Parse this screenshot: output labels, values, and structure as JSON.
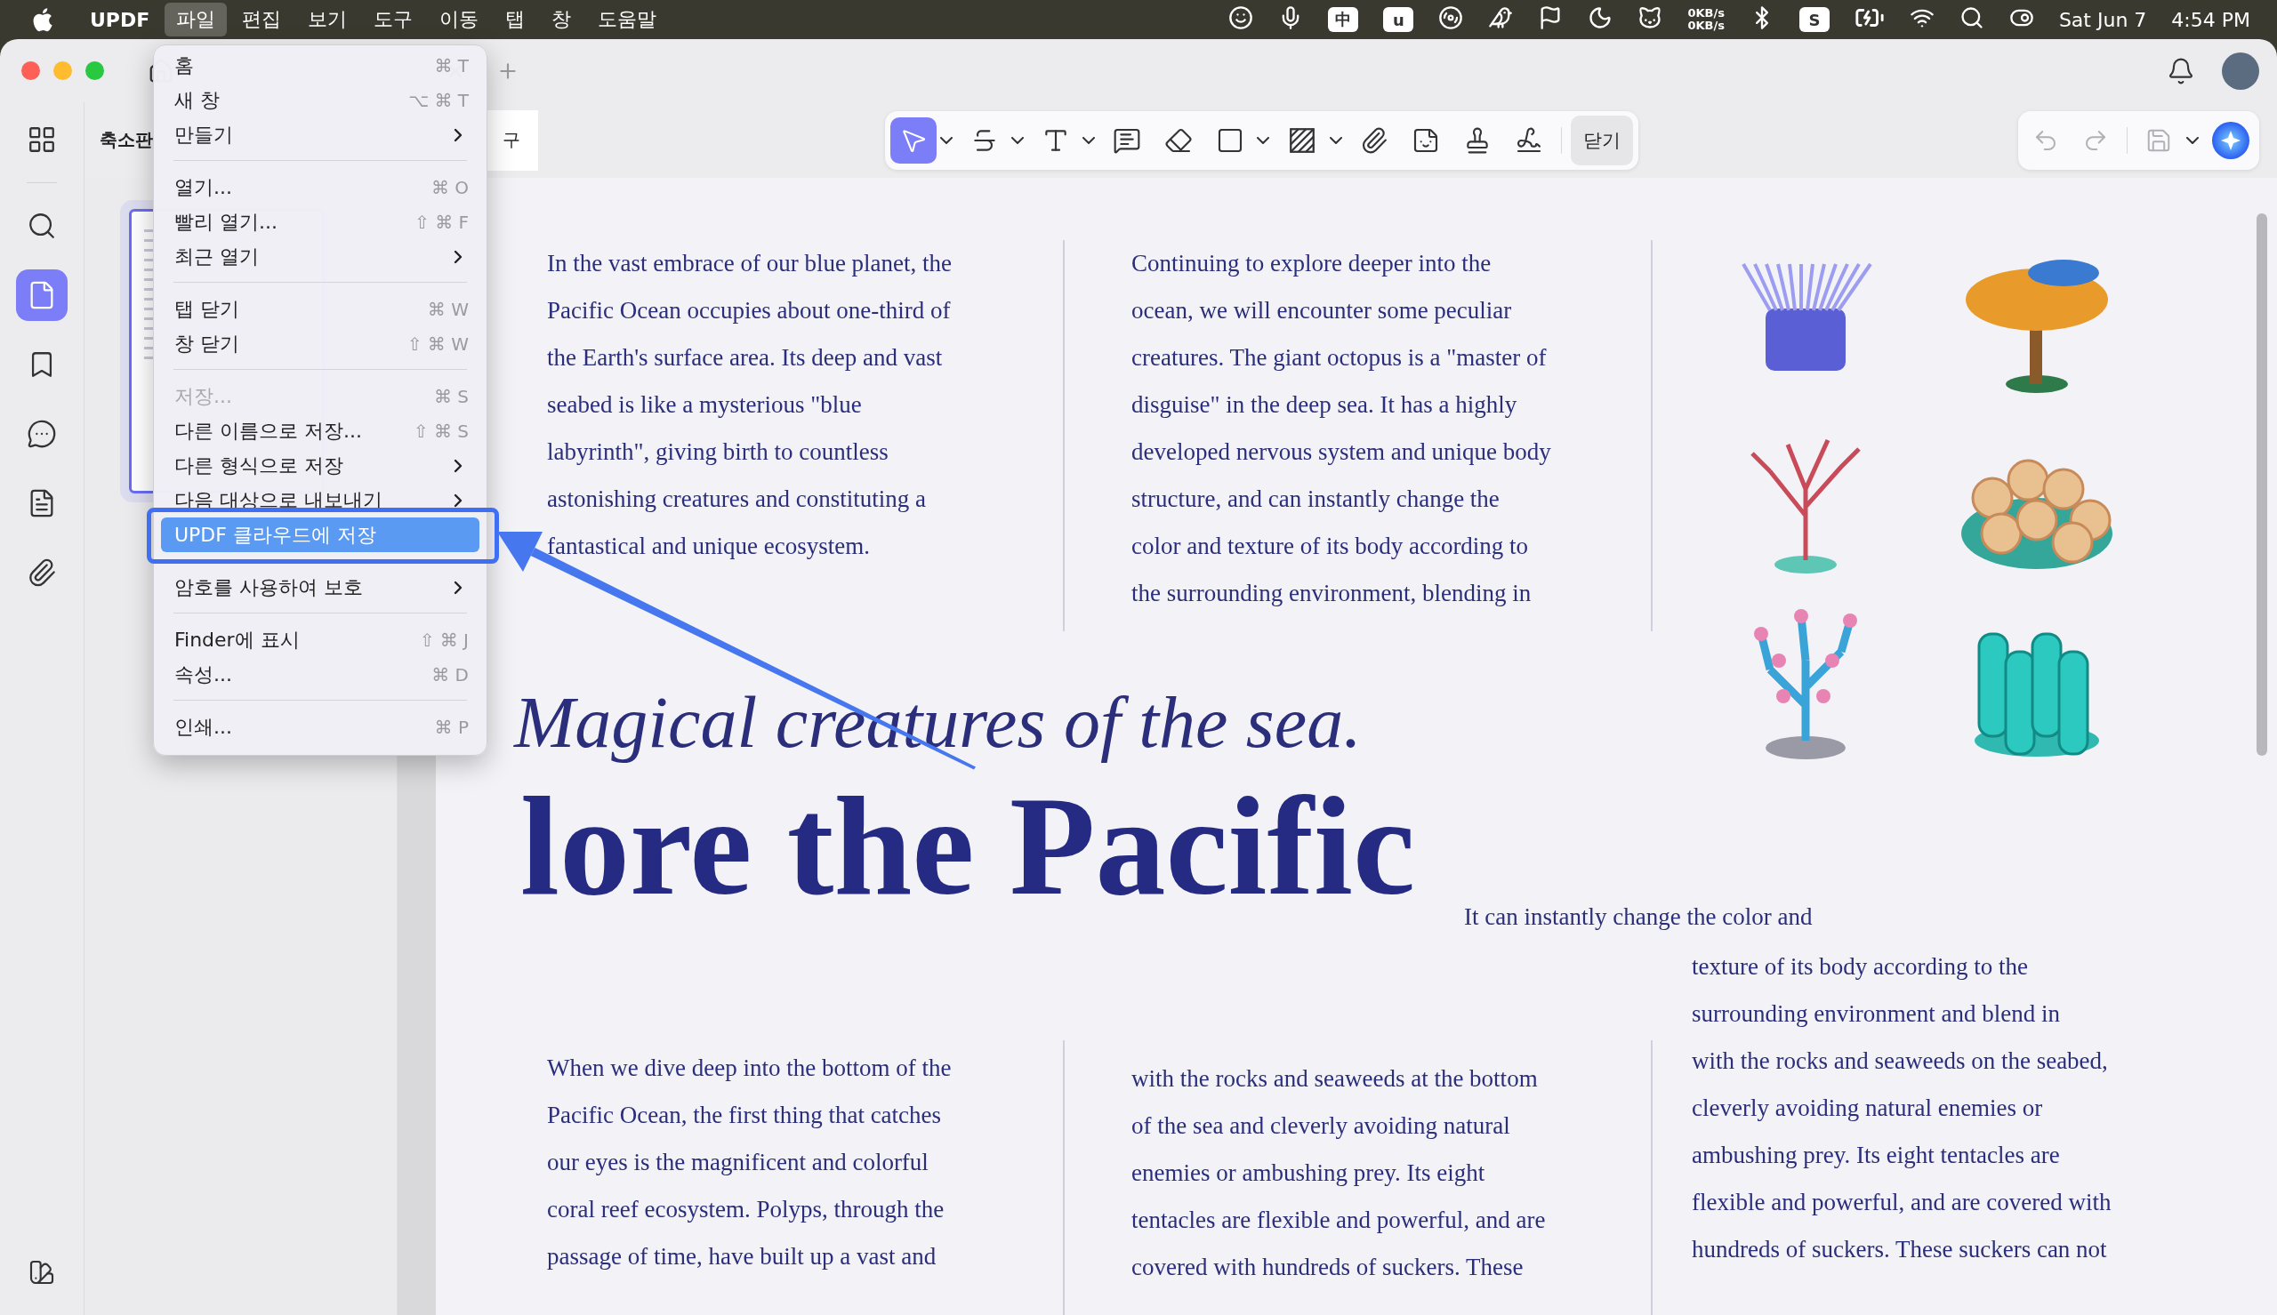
{
  "menu_bar": {
    "app_name": "UPDF",
    "menus": [
      {
        "label": "파일",
        "selected": true
      },
      {
        "label": "편집",
        "selected": false
      },
      {
        "label": "보기",
        "selected": false
      },
      {
        "label": "도구",
        "selected": false
      },
      {
        "label": "이동",
        "selected": false
      },
      {
        "label": "탭",
        "selected": false
      },
      {
        "label": "창",
        "selected": false
      },
      {
        "label": "도움말",
        "selected": false
      }
    ],
    "status_items": [
      {
        "kind": "smiley"
      },
      {
        "kind": "mic"
      },
      {
        "kind": "ime",
        "label": "中"
      },
      {
        "kind": "app",
        "label": "u"
      },
      {
        "kind": "disk"
      },
      {
        "kind": "bird"
      },
      {
        "kind": "flag"
      },
      {
        "kind": "moon"
      },
      {
        "kind": "cat"
      },
      {
        "kind": "netspeed",
        "lines": [
          "0KB/s",
          "0KB/s"
        ]
      },
      {
        "kind": "bluetooth"
      },
      {
        "kind": "app",
        "label": "S"
      },
      {
        "kind": "battery"
      },
      {
        "kind": "wifi"
      },
      {
        "kind": "search"
      },
      {
        "kind": "control"
      }
    ],
    "date": "Sat Jun 7",
    "time": "4:54 PM"
  },
  "sidebar": {
    "items": [
      {
        "kind": "grid",
        "selected": false
      },
      {
        "kind": "search",
        "selected": false
      },
      {
        "kind": "pages",
        "selected": true
      },
      {
        "kind": "bookmark",
        "selected": false
      },
      {
        "kind": "comment",
        "selected": false
      },
      {
        "kind": "form",
        "selected": false
      },
      {
        "kind": "attachment",
        "selected": false
      }
    ],
    "bottom": {
      "kind": "theme"
    }
  },
  "panel": {
    "title": "축소판",
    "button": "구",
    "thumbnail": {
      "selected": true
    }
  },
  "toolbar": {
    "tools": [
      {
        "kind": "select",
        "selected": true,
        "dropdown": true
      },
      {
        "kind": "strikethrough",
        "selected": false,
        "dropdown": true
      },
      {
        "kind": "text",
        "selected": false,
        "dropdown": true
      },
      {
        "kind": "comment",
        "selected": false,
        "dropdown": false
      },
      {
        "kind": "eraser",
        "selected": false,
        "dropdown": false
      },
      {
        "kind": "rectangle",
        "selected": false,
        "dropdown": true
      },
      {
        "kind": "hatch",
        "selected": false,
        "dropdown": true
      },
      {
        "kind": "attachment",
        "selected": false,
        "dropdown": false
      },
      {
        "kind": "sticker",
        "selected": false,
        "dropdown": false
      },
      {
        "kind": "stamp",
        "selected": false,
        "dropdown": false
      },
      {
        "kind": "signature",
        "selected": false,
        "dropdown": false
      }
    ],
    "close_button": "닫기",
    "history": [
      {
        "kind": "undo",
        "disabled": true,
        "dropdown": false
      },
      {
        "kind": "redo",
        "disabled": true,
        "dropdown": false
      },
      {
        "kind": "save",
        "disabled": true,
        "dropdown": true
      },
      {
        "kind": "ai"
      }
    ]
  },
  "file_menu": {
    "items": [
      {
        "kind": "item",
        "label": "홈",
        "shortcut": "⌘ T",
        "submenu": false,
        "disabled": false,
        "selected": false
      },
      {
        "kind": "item",
        "label": "새 창",
        "shortcut": "⌥ ⌘ T",
        "submenu": false,
        "disabled": false,
        "selected": false
      },
      {
        "kind": "item",
        "label": "만들기",
        "submenu": true,
        "disabled": false,
        "selected": false
      },
      {
        "kind": "separator"
      },
      {
        "kind": "item",
        "label": "열기...",
        "shortcut": "⌘ O",
        "submenu": false,
        "disabled": false,
        "selected": false
      },
      {
        "kind": "item",
        "label": "빨리 열기...",
        "shortcut": "⇧ ⌘ F",
        "submenu": false,
        "disabled": false,
        "selected": false
      },
      {
        "kind": "item",
        "label": "최근 열기",
        "submenu": true,
        "disabled": false,
        "selected": false
      },
      {
        "kind": "separator"
      },
      {
        "kind": "item",
        "label": "탭 닫기",
        "shortcut": "⌘ W",
        "submenu": false,
        "disabled": false,
        "selected": false
      },
      {
        "kind": "item",
        "label": "창 닫기",
        "shortcut": "⇧ ⌘ W",
        "submenu": false,
        "disabled": false,
        "selected": false
      },
      {
        "kind": "separator"
      },
      {
        "kind": "item",
        "label": "저장...",
        "shortcut": "⌘ S",
        "submenu": false,
        "disabled": true,
        "selected": false
      },
      {
        "kind": "item",
        "label": "다른 이름으로 저장...",
        "shortcut": "⇧ ⌘ S",
        "submenu": false,
        "disabled": false,
        "selected": false
      },
      {
        "kind": "item",
        "label": "다른 형식으로 저장",
        "submenu": true,
        "disabled": false,
        "selected": false
      },
      {
        "kind": "item",
        "label": "다음 대상으로 내보내기",
        "submenu": true,
        "disabled": false,
        "selected": false
      },
      {
        "kind": "item",
        "label": "UPDF 클라우드에 저장",
        "submenu": false,
        "disabled": false,
        "selected": true
      },
      {
        "kind": "item",
        "label": "암호를 사용하여 보호",
        "submenu": true,
        "disabled": false,
        "selected": false
      },
      {
        "kind": "separator"
      },
      {
        "kind": "item",
        "label": "Finder에 표시",
        "shortcut": "⇧ ⌘ J",
        "submenu": false,
        "disabled": false,
        "selected": false
      },
      {
        "kind": "item",
        "label": "속성...",
        "shortcut": "⌘ D",
        "submenu": false,
        "disabled": false,
        "selected": false
      },
      {
        "kind": "separator"
      },
      {
        "kind": "item",
        "label": "인쇄...",
        "shortcut": "⌘ P",
        "submenu": false,
        "disabled": false,
        "selected": false
      }
    ]
  },
  "document": {
    "top_columns": [
      {
        "lines": [
          "In the vast embrace of our blue planet, the",
          "Pacific Ocean occupies about one-third of",
          "the Earth's surface area. Its deep and vast",
          "seabed is like a mysterious \"blue",
          "labyrinth\", giving birth to countless",
          "astonishing creatures and constituting a",
          "fantastical and unique ecosystem."
        ]
      },
      {
        "lines": [
          "Continuing to explore deeper into the",
          "ocean, we will encounter some peculiar",
          "creatures. The giant octopus is a \"master of",
          "disguise\" in the deep sea. It has a highly",
          "developed nervous system and unique body",
          "structure, and can instantly change the",
          "color and texture of its body according to",
          "the surrounding environment, blending in"
        ]
      }
    ],
    "subtitle": "Magical creatures of the sea.",
    "title": "lore the Pacific",
    "side_note": "It can instantly change the color and",
    "bottom_columns": [
      {
        "lines": [
          "When we dive deep into the bottom of the",
          "Pacific Ocean, the first thing that catches",
          "our eyes is the magnificent and colorful",
          "coral reef ecosystem. Polyps, through the",
          "passage of time, have built up a vast and"
        ]
      },
      {
        "lines": [
          "with the rocks and seaweeds at the bottom",
          "of the sea and cleverly avoiding natural",
          "enemies or ambushing prey. Its eight",
          "tentacles are flexible and powerful, and are",
          "covered with hundreds of suckers. These"
        ]
      },
      {
        "lines": [
          "texture of its body according to the",
          "surrounding environment and blend in",
          "with the rocks and seaweeds on the seabed,",
          "cleverly avoiding natural enemies or",
          "ambushing prey. Its eight tentacles are",
          "flexible and powerful, and are covered with",
          "hundreds of suckers. These suckers can not"
        ]
      }
    ]
  }
}
